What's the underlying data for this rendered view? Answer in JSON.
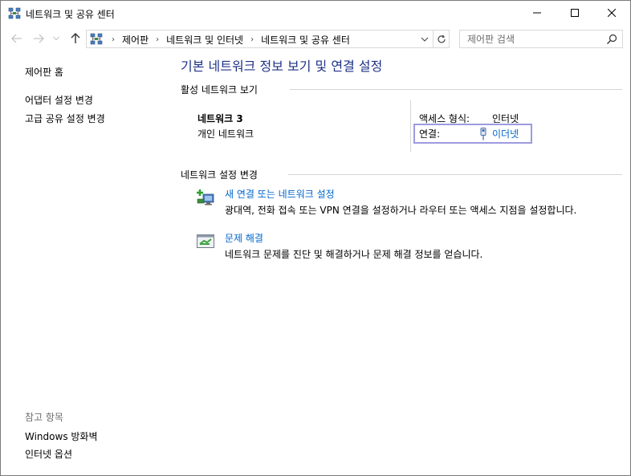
{
  "window": {
    "title": "네트워크 및 공유 센터"
  },
  "address": {
    "crumbs": [
      "제어판",
      "네트워크 및 인터넷",
      "네트워크 및 공유 센터"
    ],
    "search_placeholder": "제어판 검색"
  },
  "left_pane": {
    "home": "제어판 홈",
    "links": [
      "어댑터 설정 변경",
      "고급 공유 설정 변경"
    ],
    "see_also_header": "참고 항목",
    "see_also": [
      "Windows 방화벽",
      "인터넷 옵션"
    ]
  },
  "main": {
    "title": "기본 네트워크 정보 보기 및 연결 설정",
    "active_header": "활성 네트워크 보기",
    "network": {
      "name": "네트워크  3",
      "type": "개인 네트워크",
      "access_label": "액세스 형식:",
      "access_value": "인터넷",
      "connection_label": "연결:",
      "connection_value": "이더넷"
    },
    "settings_header": "네트워크 설정 변경",
    "tasks": [
      {
        "link": "새 연결 또는 네트워크 설정",
        "desc": "광대역, 전화 접속 또는 VPN 연결을 설정하거나 라우터 또는 액세스 지점을 설정합니다.",
        "icon": "new-connection-icon"
      },
      {
        "link": "문제 해결",
        "desc": "네트워크 문제를 진단 및 해결하거나 문제 해결 정보를 얻습니다.",
        "icon": "troubleshoot-icon"
      }
    ]
  },
  "colors": {
    "title_blue": "#1e3287",
    "link_blue": "#0066cc",
    "highlight_border": "#9c9be0",
    "grey_text": "#6d6d6d"
  }
}
